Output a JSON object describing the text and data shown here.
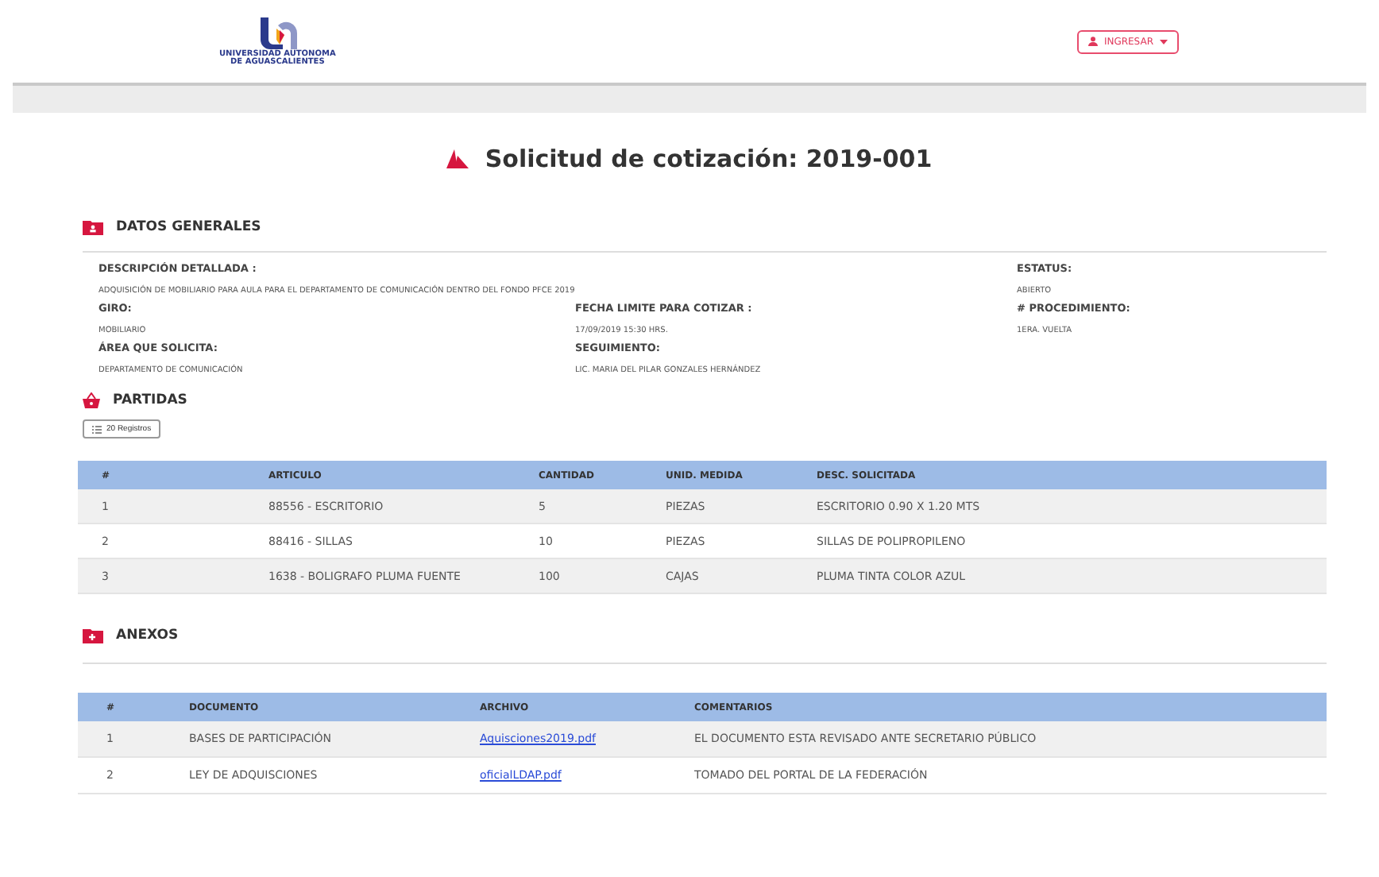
{
  "header": {
    "logo_lines": [
      "UNIVERSIDAD AUTONOMA",
      "DE AGUASCALIENTES"
    ],
    "login_button": "INGRESAR"
  },
  "title": "Solicitud de cotización: 2019-001",
  "general": {
    "heading": "DATOS GENERALES",
    "description": {
      "label": "DESCRIPCIÓN DETALLADA  :",
      "value": "ADQUISICIÓN DE MOBILIARIO PARA AULA PARA EL DEPARTAMENTO DE COMUNICACIÓN DENTRO DEL FONDO  PFCE 2019"
    },
    "status": {
      "label": "ESTATUS:",
      "value": "ABIERTO"
    },
    "fields": [
      {
        "label": "GIRO:",
        "value": "MOBILIARIO"
      },
      {
        "label": "FECHA LIMITE PARA COTIZAR :",
        "value": "17/09/2019 15:30 HRS."
      },
      {
        "label": "# PROCEDIMIENTO:",
        "value": "1ERA. VUELTA"
      },
      {
        "label": "ÁREA QUE SOLICITA:",
        "value": "DEPARTAMENTO DE COMUNICACIÓN"
      },
      {
        "label": "SEGUIMIENTO:",
        "value": "LIC. MARIA DEL PILAR GONZALES HERNÁNDEZ"
      }
    ]
  },
  "partidas": {
    "heading": "PARTIDAS",
    "records_button": "20 Registros",
    "columns": [
      "#",
      "ARTICULO",
      "CANTIDAD",
      "UNID. MEDIDA",
      "DESC. SOLICITADA"
    ],
    "rows": [
      [
        "1",
        "88556 - ESCRITORIO",
        "5",
        "PIEZAS",
        "ESCRITORIO 0.90 X 1.20 MTS"
      ],
      [
        "2",
        "88416 - SILLAS",
        "10",
        "PIEZAS",
        "SILLAS DE POLIPROPILENO"
      ],
      [
        "3",
        "1638 - BOLIGRAFO PLUMA FUENTE",
        "100",
        "CAJAS",
        "PLUMA TINTA COLOR AZUL"
      ]
    ]
  },
  "anexos": {
    "heading": "ANEXOS",
    "columns": [
      "#",
      "DOCUMENTO",
      "ARCHIVO",
      "COMENTARIOS"
    ],
    "rows": [
      {
        "number": "1",
        "document": "BASES DE PARTICIPACIÓN",
        "file": "Aquisciones2019.pdf",
        "comment": "EL DOCUMENTO ESTA REVISADO ANTE SECRETARIO PÚBLICO"
      },
      {
        "number": "2",
        "document": "LEY DE ADQUISCIONES",
        "file": "oficialLDAP.pdf",
        "comment": "TOMADO DEL PORTAL DE LA FEDERACIÓN"
      }
    ]
  }
}
